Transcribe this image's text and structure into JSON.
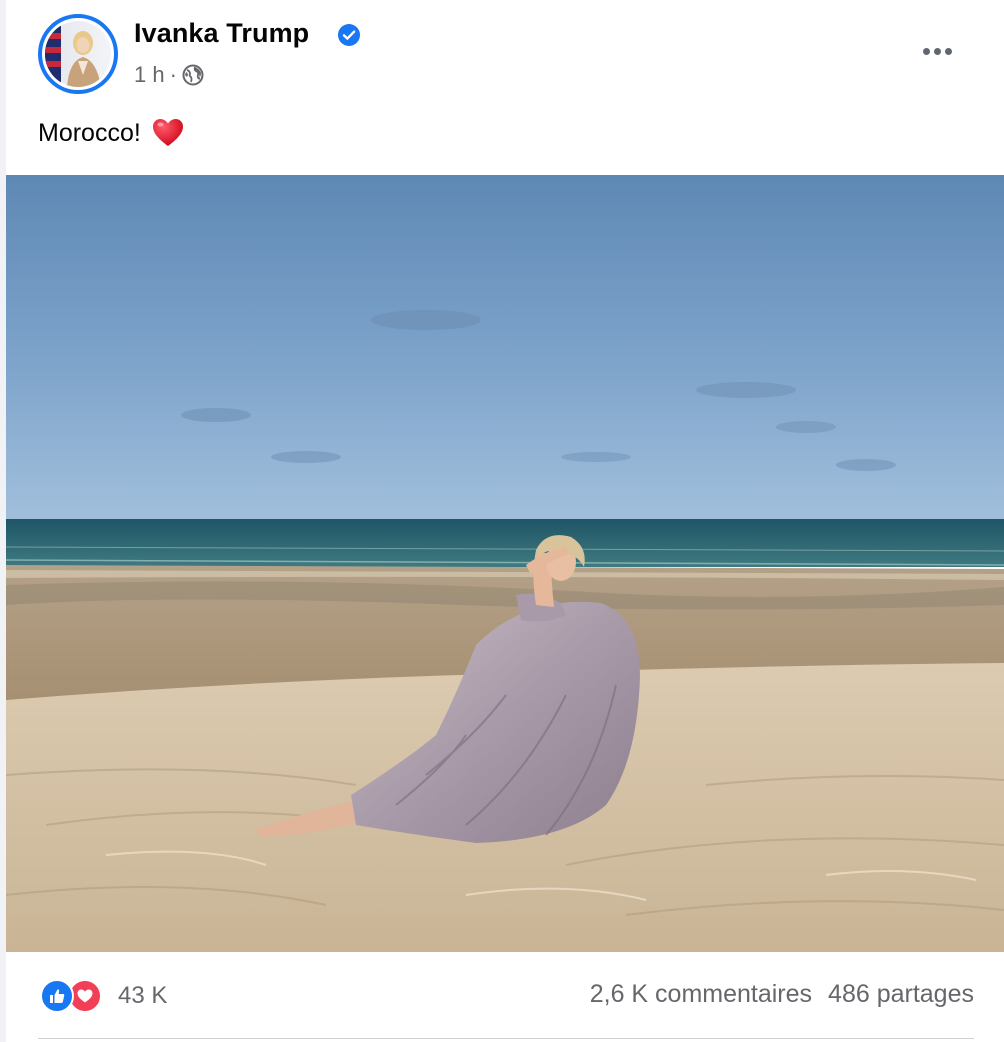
{
  "post": {
    "author": "Ivanka Trump",
    "verified": true,
    "time": "1 h",
    "separator": "·",
    "privacy_icon": "globe-icon",
    "caption": "Morocco!",
    "caption_emoji": "red-heart",
    "image_alt": "Woman in a patterned wrap sitting on a sand dune by the sea"
  },
  "engagement": {
    "reaction_icons": [
      "like-icon",
      "love-icon"
    ],
    "reaction_count": "43 K",
    "comments": "2,6 K commentaires",
    "shares": "486 partages"
  },
  "colors": {
    "brand_blue": "#1877f2",
    "love_red": "#f33e58",
    "secondary_text": "#65676b"
  }
}
